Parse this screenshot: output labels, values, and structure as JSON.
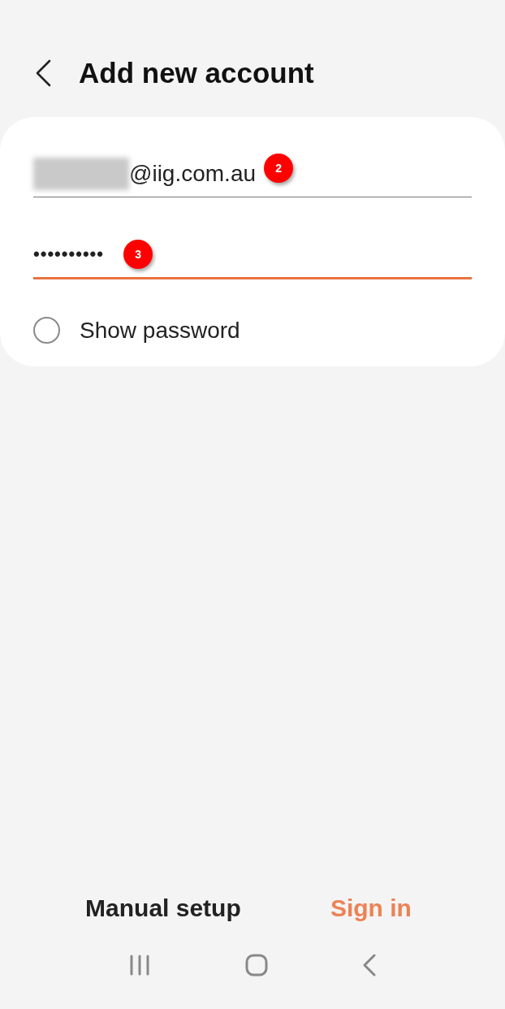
{
  "header": {
    "title": "Add new account"
  },
  "fields": [
    {
      "kind": "email",
      "value": "@iig.com.au",
      "redacted": true,
      "focused": false,
      "badge": "2"
    },
    {
      "kind": "password",
      "value": "••••••••••",
      "redacted": false,
      "focused": true,
      "badge": "3"
    }
  ],
  "show_password": {
    "label": "Show password",
    "checked": false
  },
  "buttons": [
    {
      "label": "Manual setup",
      "kind": "plain"
    },
    {
      "label": "Sign in",
      "kind": "accent"
    }
  ]
}
